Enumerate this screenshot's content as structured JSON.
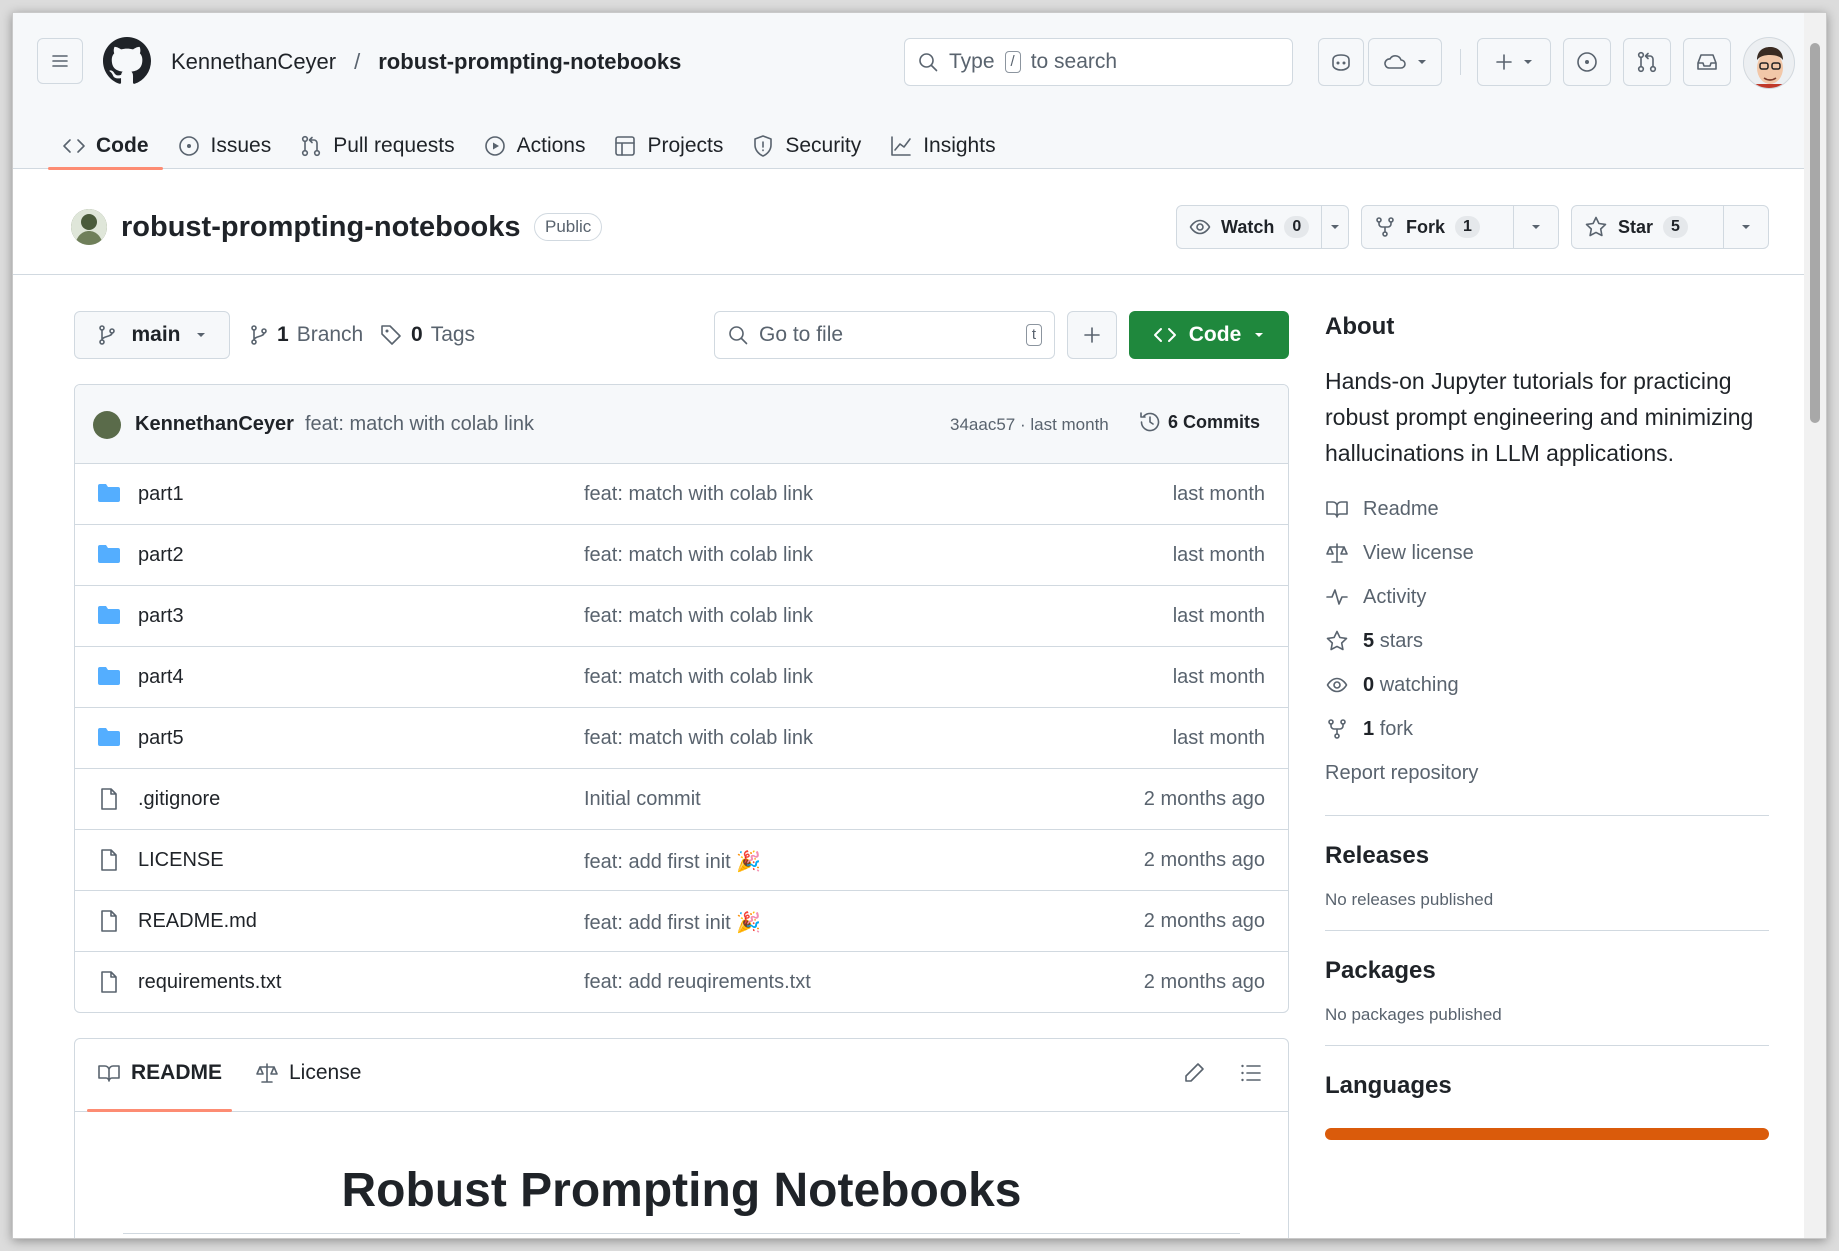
{
  "header": {
    "owner": "KennethanCeyer",
    "separator": "/",
    "repo": "robust-prompting-notebooks",
    "search_prefix": "Type",
    "search_key": "/",
    "search_suffix": "to search"
  },
  "tabs": [
    {
      "label": "Code"
    },
    {
      "label": "Issues"
    },
    {
      "label": "Pull requests"
    },
    {
      "label": "Actions"
    },
    {
      "label": "Projects"
    },
    {
      "label": "Security"
    },
    {
      "label": "Insights"
    }
  ],
  "repo_header": {
    "name": "robust-prompting-notebooks",
    "visibility": "Public",
    "watch_label": "Watch",
    "watch_count": "0",
    "fork_label": "Fork",
    "fork_count": "1",
    "star_label": "Star",
    "star_count": "5"
  },
  "toolbar": {
    "branch": "main",
    "branches_count": "1",
    "branches_label": "Branch",
    "tags_count": "0",
    "tags_label": "Tags",
    "goto_placeholder": "Go to file",
    "goto_key": "t",
    "code_label": "Code"
  },
  "latest_commit": {
    "author": "KennethanCeyer",
    "message": "feat: match with colab link",
    "hash_time": "34aac57 · last month",
    "commits_label": "6 Commits"
  },
  "files": [
    {
      "name": "part1",
      "type": "dir",
      "message": "feat: match with colab link",
      "date": "last month"
    },
    {
      "name": "part2",
      "type": "dir",
      "message": "feat: match with colab link",
      "date": "last month"
    },
    {
      "name": "part3",
      "type": "dir",
      "message": "feat: match with colab link",
      "date": "last month"
    },
    {
      "name": "part4",
      "type": "dir",
      "message": "feat: match with colab link",
      "date": "last month"
    },
    {
      "name": "part5",
      "type": "dir",
      "message": "feat: match with colab link",
      "date": "last month"
    },
    {
      "name": ".gitignore",
      "type": "file",
      "message": "Initial commit",
      "date": "2 months ago"
    },
    {
      "name": "LICENSE",
      "type": "file",
      "message": "feat: add first init 🎉",
      "date": "2 months ago"
    },
    {
      "name": "README.md",
      "type": "file",
      "message": "feat: add first init 🎉",
      "date": "2 months ago"
    },
    {
      "name": "requirements.txt",
      "type": "file",
      "message": "feat: add reuqirements.txt",
      "date": "2 months ago"
    }
  ],
  "readme": {
    "tab_readme": "README",
    "tab_license": "License",
    "title": "Robust Prompting Notebooks"
  },
  "sidebar": {
    "about_title": "About",
    "description": "Hands-on Jupyter tutorials for practicing robust prompt engineering and minimizing hallucinations in LLM applications.",
    "readme": "Readme",
    "license": "View license",
    "activity": "Activity",
    "stars_count": "5",
    "stars_label": "stars",
    "watching_count": "0",
    "watching_label": "watching",
    "fork_count": "1",
    "fork_label": "fork",
    "report": "Report repository",
    "releases_title": "Releases",
    "releases_text": "No releases published",
    "packages_title": "Packages",
    "packages_text": "No packages published",
    "languages_title": "Languages"
  },
  "colors": {
    "accent_green": "#1f883d",
    "tab_underline": "#fd8c73",
    "folder_blue": "#54aeff",
    "language_orange": "#da5b0b"
  }
}
